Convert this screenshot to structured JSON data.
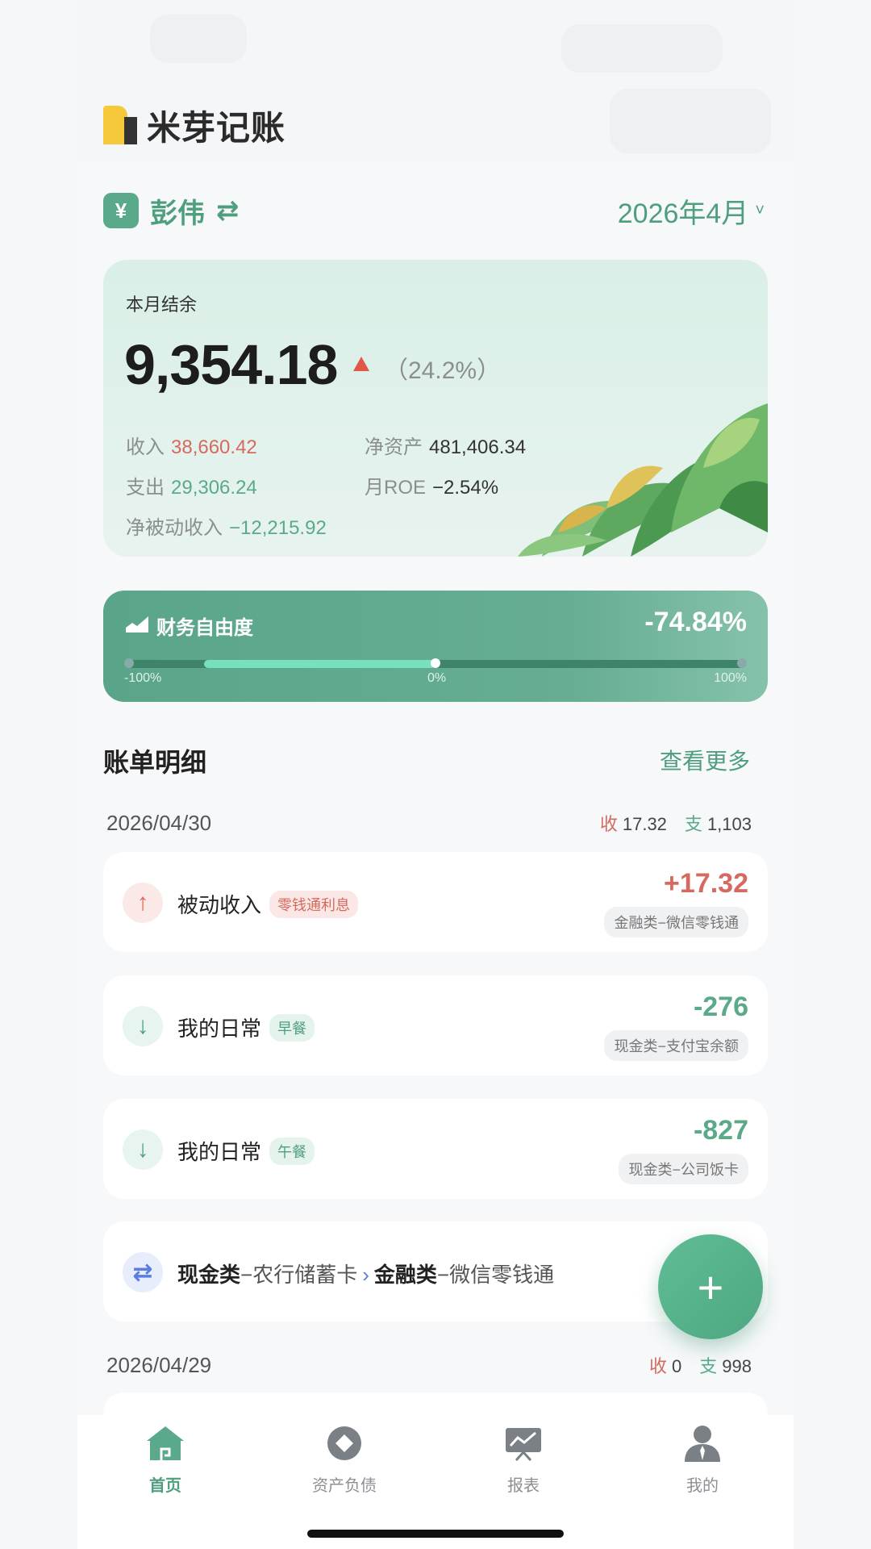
{
  "app": {
    "name": "米芽记账"
  },
  "account": {
    "name": "彭伟",
    "swap_symbol": "⇄",
    "currency_symbol": "¥",
    "month": "2026年4月",
    "month_chevron": "˅"
  },
  "balance": {
    "label": "本月结余",
    "amount": "9,354.18",
    "change_pct": "（24.2%）",
    "income_label": "收入",
    "income": "38,660.42",
    "expense_label": "支出",
    "expense": "29,306.24",
    "net_asset_label": "净资产",
    "net_asset": "481,406.34",
    "roe_label": "月ROE",
    "roe": "−2.54%",
    "passive_label": "净被动收入",
    "passive": "−12,215.92"
  },
  "freedom": {
    "title": "财务自由度",
    "value": "-74.84%",
    "value_fraction": -0.7484,
    "tick_min": "-100%",
    "tick_mid": "0%",
    "tick_max": "100%"
  },
  "bills": {
    "title": "账单明细",
    "more": "查看更多",
    "groups": [
      {
        "date": "2026/04/30",
        "in_label": "收",
        "in_total": "17.32",
        "out_label": "支",
        "out_total": "1,103",
        "items": [
          {
            "category": "被动收入",
            "tag": "零钱通利息",
            "amount": "+17.32",
            "account": "金融类−微信零钱通",
            "icon": "arrow-up-icon"
          },
          {
            "category": "我的日常",
            "tag": "早餐",
            "amount": "-276",
            "account": "现金类−支付宝余额",
            "icon": "arrow-down-icon"
          },
          {
            "category": "我的日常",
            "tag": "午餐",
            "amount": "-827",
            "account": "现金类−公司饭卡",
            "icon": "arrow-down-icon"
          },
          {
            "from_type": "现金类",
            "from_acct": "−农行储蓄卡",
            "arrow": "›",
            "to_type": "金融类",
            "to_acct": "−微信零钱通",
            "icon": "transfer-icon"
          }
        ]
      },
      {
        "date": "2026/04/29",
        "in_label": "收",
        "in_total": "0",
        "out_label": "支",
        "out_total": "998"
      }
    ]
  },
  "fab": {
    "label": "+"
  },
  "tabs": [
    {
      "label": "首页",
      "icon": "home-icon",
      "active": true
    },
    {
      "label": "资产负债",
      "icon": "balance-sheet-icon"
    },
    {
      "label": "报表",
      "icon": "report-icon"
    },
    {
      "label": "我的",
      "icon": "profile-icon"
    }
  ],
  "colors": {
    "accent": "#4f9e7d",
    "income": "#d66a5e",
    "expense": "#5aaa88",
    "transfer": "#5a7de0"
  }
}
